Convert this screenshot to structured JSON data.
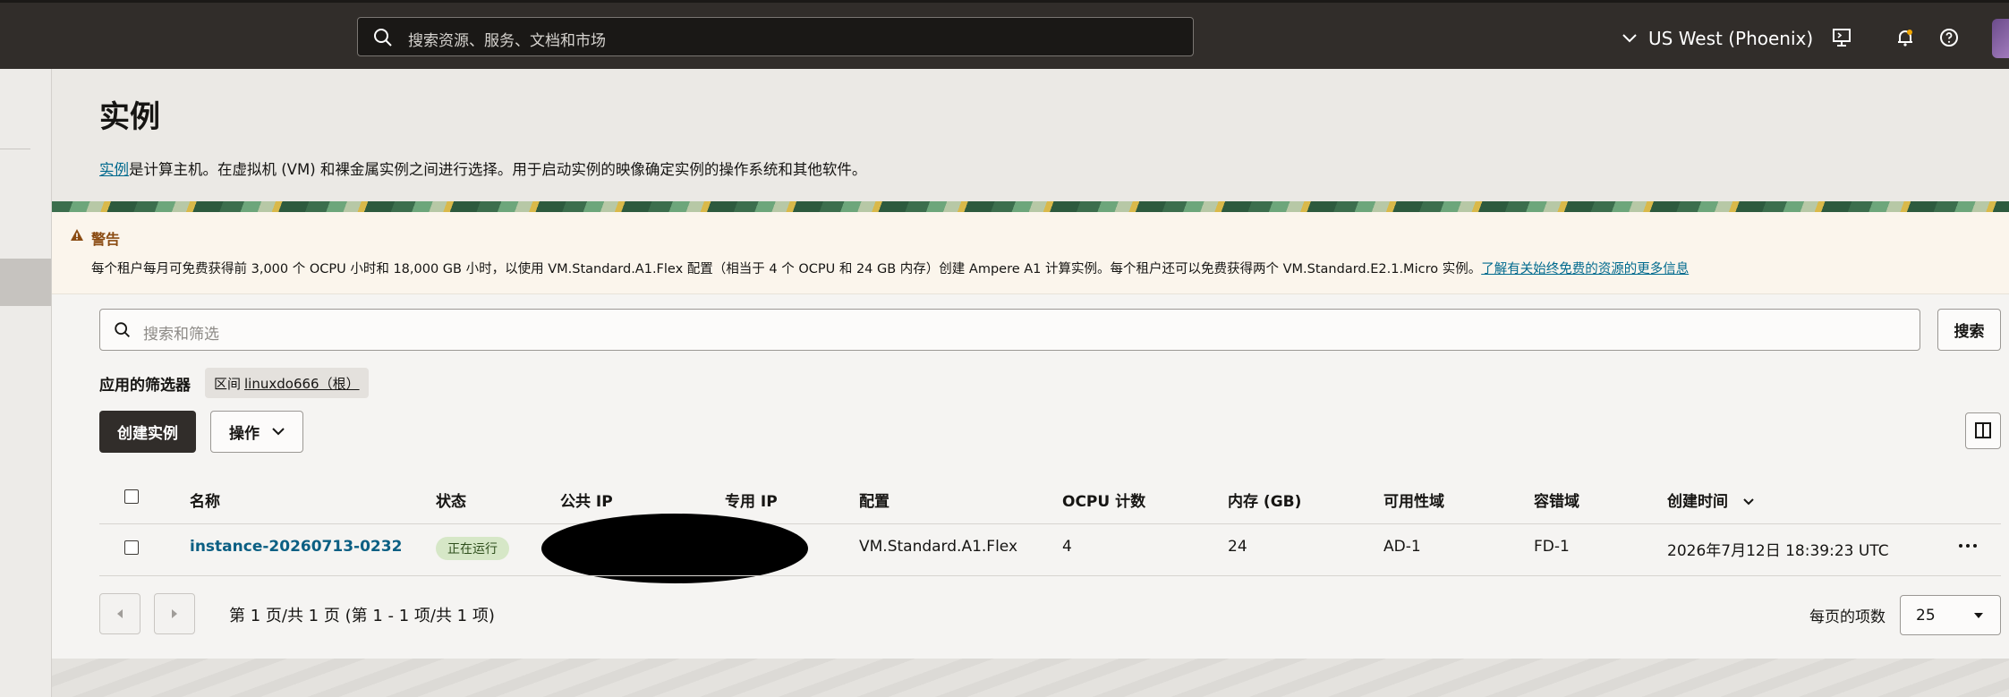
{
  "topbar": {
    "search_placeholder": "搜索资源、服务、文档和市场",
    "region": "US West (Phoenix)",
    "icons": [
      "search-icon",
      "chevron-down-icon",
      "cloud-shell-icon",
      "bell-icon",
      "help-icon"
    ]
  },
  "page": {
    "title": "实例",
    "desc_link": "实例",
    "desc_text": "是计算主机。在虚拟机 (VM) 和裸金属实例之间进行选择。用于启动实例的映像确定实例的操作系统和其他软件。"
  },
  "warning": {
    "title": "警告",
    "text": "每个租户每月可免费获得前 3,000 个 OCPU 小时和 18,000 GB 小时，以使用 VM.Standard.A1.Flex 配置（相当于 4 个 OCPU 和 24 GB 内存）创建 Ampere A1 计算实例。每个租户还可以免费获得两个 VM.Standard.E2.1.Micro 实例。",
    "link": "了解有关始终免费的资源的更多信息"
  },
  "filter": {
    "placeholder": "搜索和筛选",
    "search_button": "搜索",
    "applied_label": "应用的筛选器",
    "chip_key": "区间",
    "chip_value": "linuxdo666（根）"
  },
  "toolbar": {
    "create_label": "创建实例",
    "actions_label": "操作"
  },
  "table": {
    "columns": [
      "名称",
      "状态",
      "公共 IP",
      "专用 IP",
      "配置",
      "OCPU 计数",
      "内存 (GB)",
      "可用性域",
      "容错域",
      "创建时间"
    ],
    "rows": [
      {
        "name": "instance-20260713-0232",
        "status": "正在运行",
        "shape": "VM.Standard.A1.Flex",
        "ocpu": "4",
        "memory": "24",
        "ad": "AD-1",
        "fd": "FD-1",
        "created": "2026年7月12日 18:39:23 UTC"
      }
    ]
  },
  "pagination": {
    "text": "第 1 页/共 1 页 (第 1 - 1 项/共 1 项)",
    "per_page_label": "每页的项数",
    "per_page_value": "25"
  },
  "colors": {
    "topbar": "#312d2a",
    "link": "#006a8e",
    "status_bg": "#d6e7c7",
    "warning_title": "#8a4b12"
  }
}
